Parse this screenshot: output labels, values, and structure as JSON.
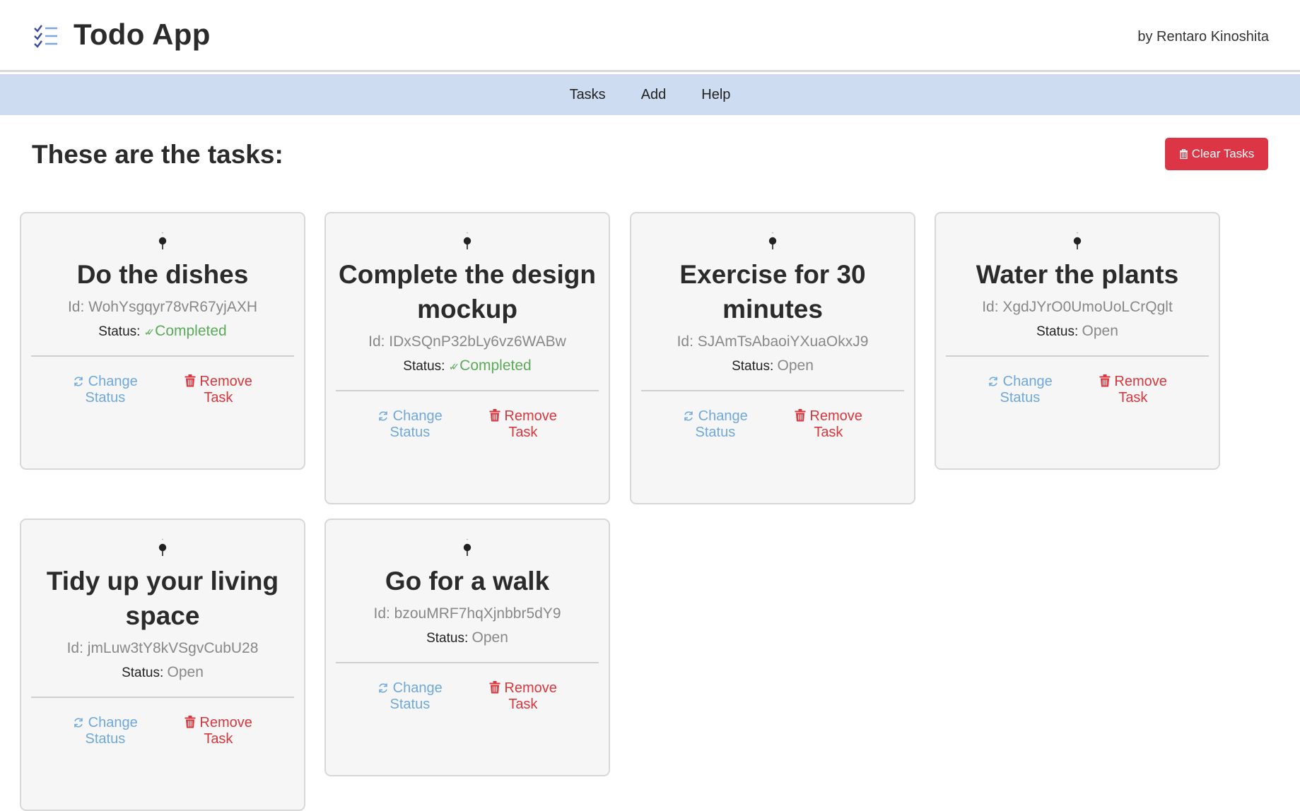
{
  "header": {
    "title": "Todo App",
    "byline": "by Rentaro Kinoshita"
  },
  "nav": {
    "items": [
      "Tasks",
      "Add",
      "Help"
    ]
  },
  "main": {
    "heading": "These are the tasks:",
    "clear_button": "Clear Tasks"
  },
  "labels": {
    "id_prefix": "Id:",
    "status_prefix": "Status:",
    "change_status": [
      "Change",
      "Status"
    ],
    "remove_task": [
      "Remove",
      "Task"
    ]
  },
  "tasks": [
    {
      "title": "Do the dishes",
      "id": "WohYsgqyr78vR67yjAXH",
      "status": "Completed"
    },
    {
      "title": "Complete the design mockup",
      "id": "IDxSQnP32bLy6vz6WABw",
      "status": "Completed"
    },
    {
      "title": "Exercise for 30 minutes",
      "id": "SJAmTsAbaoiYXuaOkxJ9",
      "status": "Open"
    },
    {
      "title": "Water the plants",
      "id": "XgdJYrO0UmoUoLCrQglt",
      "status": "Open"
    },
    {
      "title": "Tidy up your living space",
      "id": "jmLuw3tY8kVSgvCubU28",
      "status": "Open"
    },
    {
      "title": "Go for a walk",
      "id": "bzouMRF7hqXjnbbr5dY9",
      "status": "Open"
    }
  ],
  "colors": {
    "nav_bg": "#cddcf1",
    "danger": "#dc3545",
    "completed": "#5cab5a",
    "change_link": "#6fa8dc"
  }
}
